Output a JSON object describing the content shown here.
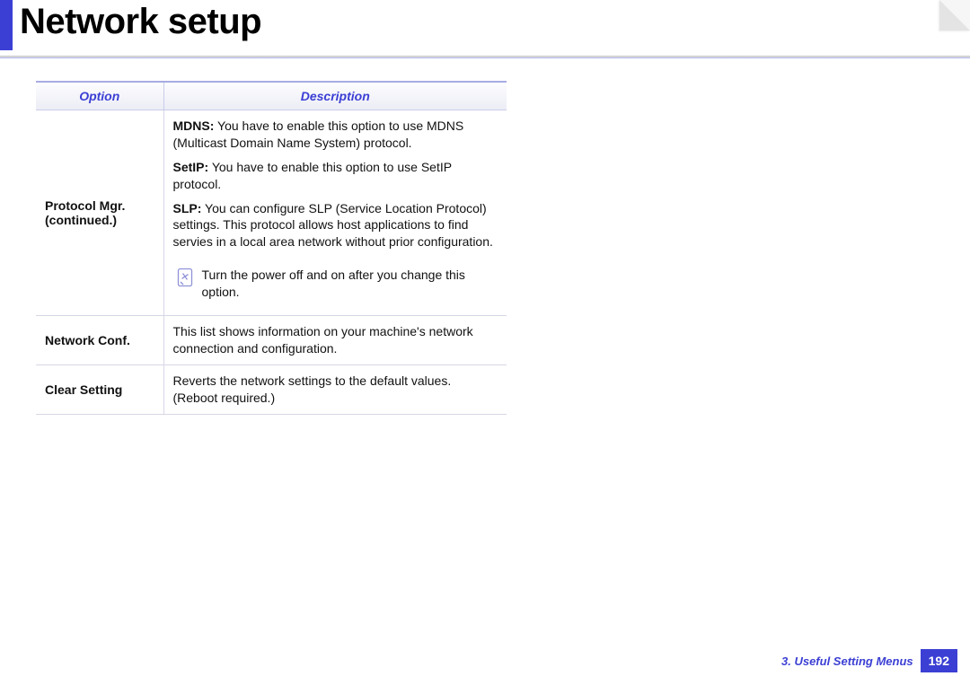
{
  "header": {
    "title": "Network setup"
  },
  "table": {
    "headers": {
      "option": "Option",
      "description": "Description"
    },
    "rows": {
      "protocol_mgr": {
        "option": "Protocol Mgr. (continued.)",
        "mdns_label": "MDNS:",
        "mdns_text": " You have to enable this option to use MDNS (Multicast Domain Name System) protocol.",
        "setip_label": "SetIP:",
        "setip_text": " You have to enable this option to use SetIP protocol.",
        "slp_label": "SLP:",
        "slp_text": " You can configure SLP (Service Location Protocol) settings. This protocol allows host applications to find servies in a local area network without prior configuration.",
        "note": "Turn the power off and on after you change this option."
      },
      "network_conf": {
        "option": "Network Conf.",
        "desc": "This list shows information on your machine's network connection and configuration."
      },
      "clear_setting": {
        "option": "Clear Setting",
        "desc": "Reverts the network settings to the default values. (Reboot required.)"
      }
    }
  },
  "footer": {
    "section": "3.  Useful Setting Menus",
    "page": "192"
  }
}
